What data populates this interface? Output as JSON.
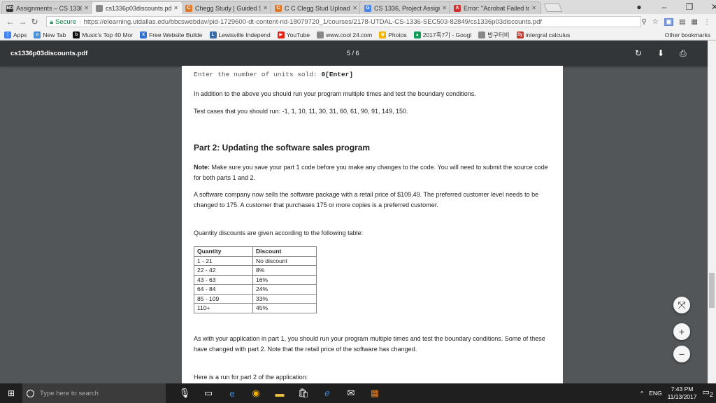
{
  "tabs": [
    {
      "title": "Assignments – CS 1336.",
      "icon": "blackboard-icon",
      "color": "#333333",
      "glyph": "Bb"
    },
    {
      "title": "cs1336p03discounts.pdf",
      "icon": "page-icon",
      "color": "#888888",
      "glyph": ""
    },
    {
      "title": "Chegg Study | Guided S",
      "icon": "chegg-icon",
      "color": "#e87722",
      "glyph": "C"
    },
    {
      "title": "C C Clegg Stud Upload",
      "icon": "chegg-icon",
      "color": "#e87722",
      "glyph": "C"
    },
    {
      "title": "CS 1336, Project Assign",
      "icon": "google-icon",
      "color": "#4285f4",
      "glyph": "G"
    },
    {
      "title": "Error: \"Acrobat Failed to",
      "icon": "acrobat-icon",
      "color": "#d32f2f",
      "glyph": "A"
    }
  ],
  "address": {
    "secure_label": "Secure",
    "url": "https://elearning.utdallas.edu/bbcswebdav/pid-1729600-dt-content-rid-18079720_1/courses/2178-UTDAL-CS-1336-SEC503-82849/cs1336p03discounts.pdf"
  },
  "bookmarks": [
    {
      "label": "Apps",
      "icon": "apps-icon",
      "color": "#4285f4",
      "glyph": "⋮"
    },
    {
      "label": "New Tab",
      "icon": "page-icon",
      "color": "#4a90d9",
      "glyph": "o"
    },
    {
      "label": "Music's Top 40 Mor",
      "icon": "b-icon",
      "color": "#111111",
      "glyph": "b"
    },
    {
      "label": "Free Website Builde",
      "icon": "x-icon",
      "color": "#2f6fd6",
      "glyph": "X"
    },
    {
      "label": "Lewisville Independ",
      "icon": "school-icon",
      "color": "#3a6aa8",
      "glyph": "L"
    },
    {
      "label": "YouTube",
      "icon": "youtube-icon",
      "color": "#e62117",
      "glyph": "▶"
    },
    {
      "label": "www.cool 24.com",
      "icon": "page-icon",
      "color": "#888888",
      "glyph": ""
    },
    {
      "label": "Photos",
      "icon": "photos-icon",
      "color": "#f4b400",
      "glyph": "✿"
    },
    {
      "label": "2017흑7기 - Googl",
      "icon": "drive-icon",
      "color": "#0f9d58",
      "glyph": "▲"
    },
    {
      "label": "방구터비",
      "icon": "page-icon",
      "color": "#888888",
      "glyph": ""
    },
    {
      "label": "intergral calculus",
      "icon": "symbolab-icon",
      "color": "#c0392b",
      "glyph": "Sy"
    }
  ],
  "other_bookmarks": "Other bookmarks",
  "pdf": {
    "filename": "cs1336p03discounts.pdf",
    "page_indicator": "5 / 6"
  },
  "content": {
    "enter_line_prefix": "Enter the number of units sold: ",
    "enter_line_value": "0[Enter]",
    "p1": "In addition to the above you should run your program multiple times and test the boundary conditions.",
    "p2": "Test cases that you should run: -1, 1, 10, 11, 30, 31, 60, 61, 90, 91, 149, 150.",
    "heading": "Part 2: Updating the software sales program",
    "note_label": "Note:",
    "note_text": " Make sure you save your part 1 code before you make any changes to the code. You will need to submit the source code for both parts 1 and 2.",
    "p3": "A software company now sells the software package with a retail price of $109.49.  The preferred customer level needs to be changed to 175. A customer that purchases 175 or more copies is a preferred customer.",
    "p4": "Quantity discounts are given according to the following table:",
    "table": {
      "headers": [
        "Quantity",
        "Discount"
      ],
      "rows": [
        [
          "1 - 21",
          "No discount"
        ],
        [
          "22 - 42",
          "8%"
        ],
        [
          "43 - 63",
          "16%"
        ],
        [
          "64 - 84",
          "24%"
        ],
        [
          "85 - 109",
          "33%"
        ],
        [
          "110+",
          "45%"
        ]
      ]
    },
    "p5": "As with your application in part 1, you should run your program multiple times and test the boundary conditions. Some of these have changed with part 2.  Note that the retail price of the software has changed.",
    "p6": "Here is a run for part 2 of the application:"
  },
  "taskbar": {
    "search_placeholder": "Type here to search",
    "lang": "ENG",
    "time": "7:43 PM",
    "date": "11/13/2017",
    "notif_count": "2"
  }
}
